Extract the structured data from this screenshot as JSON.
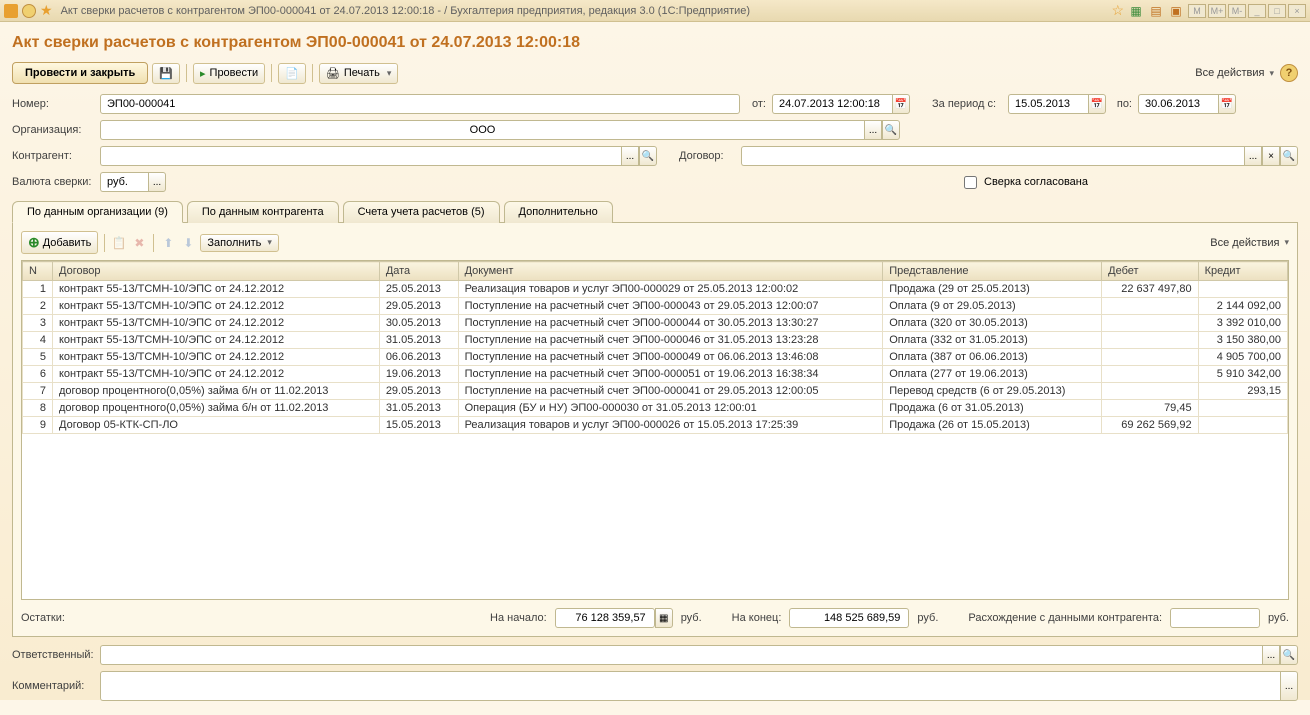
{
  "window": {
    "title": "Акт сверки расчетов с контрагентом ЭП00-000041 от 24.07.2013 12:00:18 -                                  / Бухгалтерия предприятия, редакция 3.0   (1С:Предприятие)",
    "win_icons": [
      "M",
      "M+",
      "M-"
    ]
  },
  "page_title": "Акт сверки расчетов с контрагентом ЭП00-000041 от 24.07.2013 12:00:18",
  "toolbar": {
    "post_close": "Провести и закрыть",
    "post": "Провести",
    "print": "Печать",
    "all_actions": "Все действия"
  },
  "form": {
    "number_label": "Номер:",
    "number": "ЭП00-000041",
    "from_label": "от:",
    "from": "24.07.2013 12:00:18",
    "period_from_label": "За период с:",
    "period_from": "15.05.2013",
    "period_to_label": "по:",
    "period_to": "30.06.2013",
    "org_label": "Организация:",
    "org": "ООО",
    "counterparty_label": "Контрагент:",
    "counterparty": "",
    "contract_label": "Договор:",
    "contract": "",
    "currency_label": "Валюта сверки:",
    "currency": "руб.",
    "agreed_label": "Сверка согласована"
  },
  "tabs": [
    {
      "label": "По данным организации (9)",
      "active": true
    },
    {
      "label": "По данным контрагента",
      "active": false
    },
    {
      "label": "Счета учета расчетов (5)",
      "active": false
    },
    {
      "label": "Дополнительно",
      "active": false
    }
  ],
  "table_toolbar": {
    "add": "Добавить",
    "fill": "Заполнить",
    "all_actions": "Все действия"
  },
  "table": {
    "columns": [
      "N",
      "Договор",
      "Дата",
      "Документ",
      "Представление",
      "Дебет",
      "Кредит"
    ],
    "rows": [
      {
        "n": "1",
        "contract": "контракт 55-13/ТСМН-10/ЭПС от 24.12.2012",
        "date": "25.05.2013",
        "doc": "Реализация товаров и услуг ЭП00-000029 от 25.05.2013 12:00:02",
        "repr": "Продажа (29 от 25.05.2013)",
        "debit": "22 637 497,80",
        "credit": ""
      },
      {
        "n": "2",
        "contract": "контракт 55-13/ТСМН-10/ЭПС от 24.12.2012",
        "date": "29.05.2013",
        "doc": "Поступление на расчетный счет ЭП00-000043 от 29.05.2013 12:00:07",
        "repr": "Оплата (9 от 29.05.2013)",
        "debit": "",
        "credit": "2 144 092,00"
      },
      {
        "n": "3",
        "contract": "контракт 55-13/ТСМН-10/ЭПС от 24.12.2012",
        "date": "30.05.2013",
        "doc": "Поступление на расчетный счет ЭП00-000044 от 30.05.2013 13:30:27",
        "repr": "Оплата (320 от 30.05.2013)",
        "debit": "",
        "credit": "3 392 010,00"
      },
      {
        "n": "4",
        "contract": "контракт 55-13/ТСМН-10/ЭПС от 24.12.2012",
        "date": "31.05.2013",
        "doc": "Поступление на расчетный счет ЭП00-000046 от 31.05.2013 13:23:28",
        "repr": "Оплата (332 от 31.05.2013)",
        "debit": "",
        "credit": "3 150 380,00"
      },
      {
        "n": "5",
        "contract": "контракт 55-13/ТСМН-10/ЭПС от 24.12.2012",
        "date": "06.06.2013",
        "doc": "Поступление на расчетный счет ЭП00-000049 от 06.06.2013 13:46:08",
        "repr": "Оплата (387 от 06.06.2013)",
        "debit": "",
        "credit": "4 905 700,00"
      },
      {
        "n": "6",
        "contract": "контракт 55-13/ТСМН-10/ЭПС от 24.12.2012",
        "date": "19.06.2013",
        "doc": "Поступление на расчетный счет ЭП00-000051 от 19.06.2013 16:38:34",
        "repr": "Оплата (277 от 19.06.2013)",
        "debit": "",
        "credit": "5 910 342,00"
      },
      {
        "n": "7",
        "contract": "договор процентного(0,05%) займа б/н от 11.02.2013",
        "date": "29.05.2013",
        "doc": "Поступление на расчетный счет ЭП00-000041 от 29.05.2013 12:00:05",
        "repr": "Перевод средств (6 от 29.05.2013)",
        "debit": "",
        "credit": "293,15"
      },
      {
        "n": "8",
        "contract": "договор процентного(0,05%) займа б/н от 11.02.2013",
        "date": "31.05.2013",
        "doc": "Операция (БУ и НУ) ЭП00-000030 от 31.05.2013 12:00:01",
        "repr": "Продажа (6 от 31.05.2013)",
        "debit": "79,45",
        "credit": ""
      },
      {
        "n": "9",
        "contract": "Договор 05-КТК-СП-ЛО",
        "date": "15.05.2013",
        "doc": "Реализация товаров и услуг ЭП00-000026 от 15.05.2013 17:25:39",
        "repr": "Продажа (26 от 15.05.2013)",
        "debit": "69 262 569,92",
        "credit": ""
      }
    ]
  },
  "totals": {
    "balances_label": "Остатки:",
    "start_label": "На начало:",
    "start": "76 128 359,57",
    "end_label": "На конец:",
    "end": "148 525 689,59",
    "rub": "руб.",
    "diff_label": "Расхождение с данными контрагента:",
    "diff": ""
  },
  "footer": {
    "responsible_label": "Ответственный:",
    "responsible": "",
    "comment_label": "Комментарий:",
    "comment": ""
  }
}
